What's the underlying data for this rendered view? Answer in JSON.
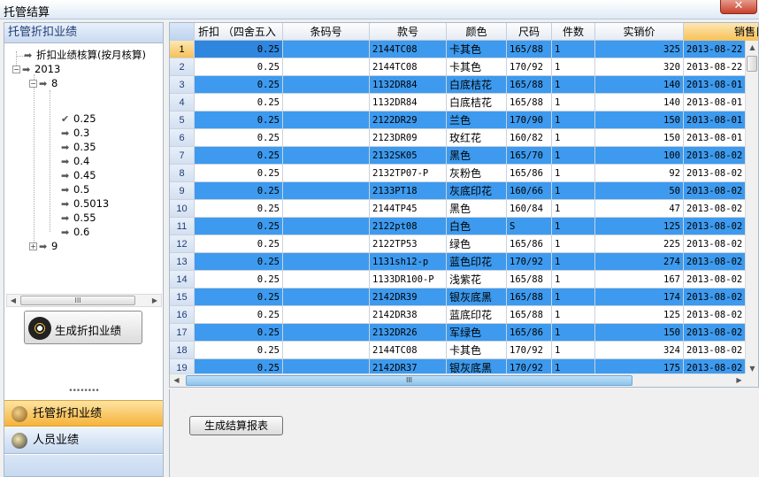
{
  "window": {
    "title": "托管结算",
    "close": "✕"
  },
  "left": {
    "header": "托管折扣业绩",
    "tree": {
      "root_item": "折扣业绩核算(按月核算)",
      "year": "2013",
      "month8": "8",
      "items": [
        "0.25",
        "0.3",
        "0.35",
        "0.4",
        "0.45",
        "0.5",
        "0.5013",
        "0.55",
        "0.6"
      ],
      "month9": "9"
    },
    "generate_button": "生成折扣业绩",
    "nav": {
      "discount": "托管折扣业绩",
      "staff": "人员业绩"
    }
  },
  "grid": {
    "columns": [
      "折扣  （四舍五入",
      "条码号",
      "款号",
      "颜色",
      "尺码",
      "件数",
      "实销价",
      "销售日期"
    ],
    "rows": [
      [
        "1",
        "0.25",
        "",
        "2144TC08",
        "卡其色",
        "165/88",
        "1",
        "325",
        "2013-08-22"
      ],
      [
        "2",
        "0.25",
        "",
        "2144TC08",
        "卡其色",
        "170/92",
        "1",
        "320",
        "2013-08-22"
      ],
      [
        "3",
        "0.25",
        "",
        "1132DR84",
        "白底桔花",
        "165/88",
        "1",
        "140",
        "2013-08-01"
      ],
      [
        "4",
        "0.25",
        "",
        "1132DR84",
        "白底桔花",
        "165/88",
        "1",
        "140",
        "2013-08-01"
      ],
      [
        "5",
        "0.25",
        "",
        "2122DR29",
        "兰色",
        "170/90",
        "1",
        "150",
        "2013-08-01"
      ],
      [
        "6",
        "0.25",
        "",
        "2123DR09",
        "玫红花",
        "160/82",
        "1",
        "150",
        "2013-08-01"
      ],
      [
        "7",
        "0.25",
        "",
        "2132SK05",
        "黑色",
        "165/70",
        "1",
        "100",
        "2013-08-02"
      ],
      [
        "8",
        "0.25",
        "",
        "2132TP07-P",
        "灰粉色",
        "165/86",
        "1",
        "92",
        "2013-08-02"
      ],
      [
        "9",
        "0.25",
        "",
        "2133PT18",
        "灰底印花",
        "160/66",
        "1",
        "50",
        "2013-08-02"
      ],
      [
        "10",
        "0.25",
        "",
        "2144TP45",
        "黑色",
        "160/84",
        "1",
        "47",
        "2013-08-02"
      ],
      [
        "11",
        "0.25",
        "",
        "2122pt08",
        "白色",
        "S",
        "1",
        "125",
        "2013-08-02"
      ],
      [
        "12",
        "0.25",
        "",
        "2122TP53",
        "绿色",
        "165/86",
        "1",
        "225",
        "2013-08-02"
      ],
      [
        "13",
        "0.25",
        "",
        "1131sh12-p",
        "蓝色印花",
        "170/92",
        "1",
        "274",
        "2013-08-02"
      ],
      [
        "14",
        "0.25",
        "",
        "1133DR100-P",
        "浅紫花",
        "165/88",
        "1",
        "167",
        "2013-08-02"
      ],
      [
        "15",
        "0.25",
        "",
        "2142DR39",
        "银灰底黑",
        "165/88",
        "1",
        "174",
        "2013-08-02"
      ],
      [
        "16",
        "0.25",
        "",
        "2142DR38",
        "蓝底印花",
        "165/88",
        "1",
        "125",
        "2013-08-02"
      ],
      [
        "17",
        "0.25",
        "",
        "2132DR26",
        "军绿色",
        "165/86",
        "1",
        "150",
        "2013-08-02"
      ],
      [
        "18",
        "0.25",
        "",
        "2144TC08",
        "卡其色",
        "170/92",
        "1",
        "324",
        "2013-08-02"
      ],
      [
        "19",
        "0.25",
        "",
        "2142DR37",
        "银灰底黑",
        "170/92",
        "1",
        "175",
        "2013-08-02"
      ]
    ]
  },
  "report_button": "生成结算报表"
}
